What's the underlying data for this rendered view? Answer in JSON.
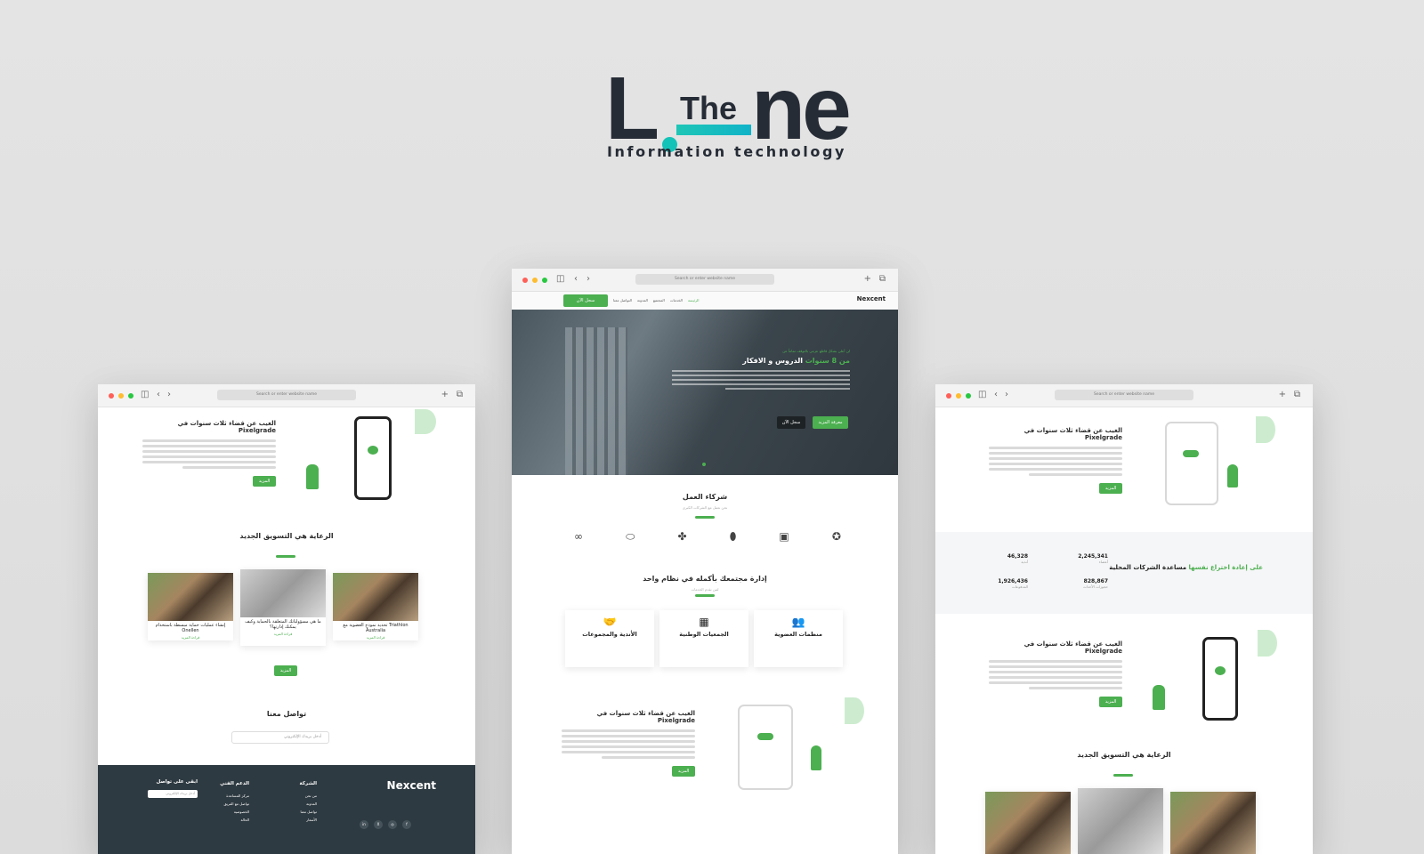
{
  "brand": {
    "letter_l": "L",
    "the": "The",
    "ne": "ne",
    "tagline": "Information technology"
  },
  "colors": {
    "accent": "#4caf50",
    "teal": "#14c3b8",
    "dark": "#262c36",
    "footer": "#2e3a41"
  },
  "browser": {
    "url_placeholder": "Search or enter website name"
  },
  "center": {
    "nav": {
      "logo": "Nexcent",
      "items": [
        "الرئيسة",
        "الخدمات",
        "المجتمع",
        "المدونة",
        "التواصل معنا"
      ],
      "cta": "سجل الآن"
    },
    "hero": {
      "kicker": "لن أعلن بشكل قاطع عزمي بالتوقف تماماً عن",
      "title_a": "الدروس و الافكار",
      "title_b": "من 8 سنوات",
      "btn_more": "معرفة المزيد",
      "btn_register": "سجل الآن"
    },
    "partners": {
      "title": "شركاء العمل",
      "sub": "نحن نعمل مع الشركات الكبرى"
    },
    "manage": {
      "title": "إدارة مجتمعك بأكمله في نظام واحد",
      "sub": "لمن نقدم الخدمات",
      "cards": [
        {
          "title": "منظمات العضوية"
        },
        {
          "title": "الجمعيات الوطنية"
        },
        {
          "title": "الأندية والمجموعات"
        }
      ]
    },
    "feature": {
      "title": "الغيب عن قضاء ثلاث سنوات في Pixelgrade",
      "btn": "المزيد"
    }
  },
  "left": {
    "feature": {
      "title": "الغيب عن قضاء ثلاث سنوات في Pixelgrade",
      "btn": "المزيد"
    },
    "marketing": {
      "title": "الرعاية هي التسويق الجديد",
      "cards": [
        {
          "title": "تحديد نموذج العضوية مع Triathlon Australia",
          "link": "قراءة المزيد"
        },
        {
          "title": "ما هي مسؤولياتك المتعلقة بالحماية وكيف يمكنك إدارتها؟",
          "link": "قراءة المزيد"
        },
        {
          "title": "إنشاء عمليات حماية مبسطة باستخدام Onellen",
          "link": "قراءة المزيد"
        }
      ],
      "btn": "المزيد"
    },
    "contact": {
      "title": "تواصل معنا",
      "placeholder": "أدخل بريدك الإلكتروني"
    },
    "footer": {
      "logo": "Nexcent",
      "col1": {
        "title": "الشركة",
        "items": [
          "من نحن",
          "المدونة",
          "تواصل معنا",
          "الأسعار"
        ]
      },
      "col2": {
        "title": "الدعم الفني",
        "items": [
          "مركز المساعدة",
          "تواصل مع الفريق",
          "الخصوصية",
          "الحالة"
        ]
      },
      "col3": {
        "title": "ابقى على تواصل",
        "placeholder": "أدخل بريدك الإلكتروني"
      },
      "social": [
        "in",
        "X",
        "◎",
        "f"
      ]
    }
  },
  "right": {
    "feature": {
      "title": "الغيب عن قضاء ثلاث سنوات في Pixelgrade",
      "btn": "المزيد"
    },
    "stats": {
      "title_a": "مساعدة الشركات المحلية",
      "title_b": "على إعادة اختراع نفسها",
      "items": [
        {
          "value": "2,245,341",
          "label": "أعضاء"
        },
        {
          "value": "46,328",
          "label": "أندية"
        },
        {
          "value": "828,867",
          "label": "حجوزات الأحداث"
        },
        {
          "value": "1,926,436",
          "label": "المدفوعات"
        }
      ]
    },
    "feature2": {
      "title": "الغيب عن قضاء ثلاث سنوات في Pixelgrade",
      "btn": "المزيد"
    },
    "marketing": {
      "title": "الرعاية هي التسويق الجديد"
    }
  }
}
